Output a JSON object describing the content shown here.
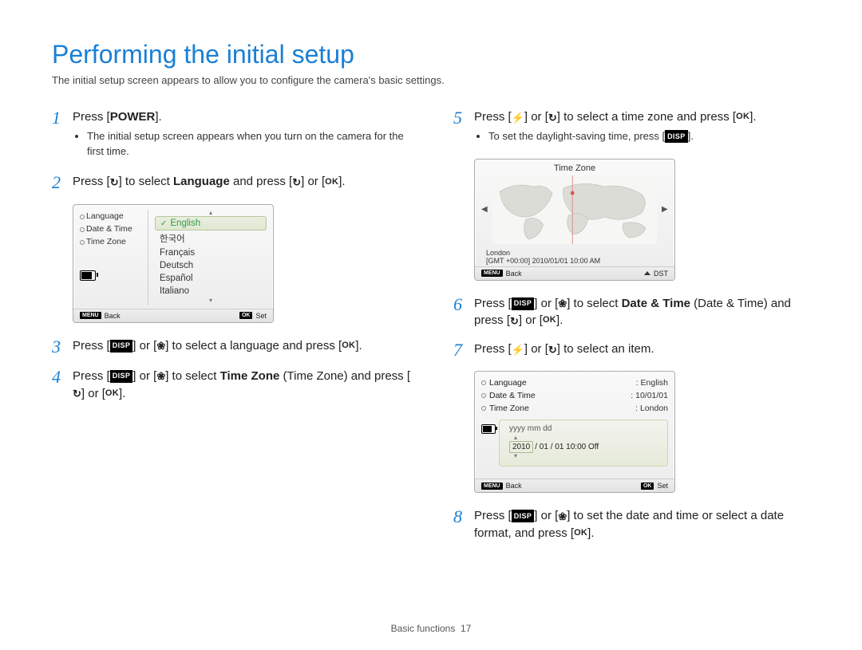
{
  "title": "Performing the initial setup",
  "subtitle": "The initial setup screen appears to allow you to configure the camera's basic settings.",
  "icons": {
    "disp_label": "DISP",
    "ok_label": "OK"
  },
  "steps": {
    "s1": {
      "num": "1",
      "pre": "Press [",
      "power": "POWER",
      "post": "].",
      "bullet": "The initial setup screen appears when you turn on the camera for the first time."
    },
    "s2": {
      "num": "2",
      "t1": "Press [",
      "t2": "] to select ",
      "lang_bold": "Language",
      "t3": " and press [",
      "t4": "] or [",
      "t5": "]."
    },
    "s3": {
      "num": "3",
      "t1": "Press [",
      "t2": "] or [",
      "t3": "] to select a language and press [",
      "t4": "]."
    },
    "s4": {
      "num": "4",
      "t1": "Press [",
      "t2": "] or [",
      "t3": "] to select ",
      "tz_bold": "Time Zone",
      "paren": " (Time Zone) and press [",
      "t4": "] or [",
      "t5": "]."
    },
    "s5": {
      "num": "5",
      "t1": "Press [",
      "t2": "] or [",
      "t3": "] to select a time zone and press [",
      "t4": "].",
      "bullet_pre": "To set the daylight-saving time, press [",
      "bullet_post": "]."
    },
    "s6": {
      "num": "6",
      "t1": "Press [",
      "t2": "] or [",
      "t3": "] to select ",
      "dt_bold": "Date & Time",
      "paren": " (Date & Time) and press [",
      "t4": "] or [",
      "t5": "]."
    },
    "s7": {
      "num": "7",
      "t1": "Press [",
      "t2": "] or [",
      "t3": "] to select an item."
    },
    "s8": {
      "num": "8",
      "t1": "Press [",
      "t2": "] or [",
      "t3": "] to set the date and time or select a date format, and press [",
      "t4": "]."
    }
  },
  "screen1": {
    "menu": [
      "Language",
      "Date & Time",
      "Time Zone"
    ],
    "langs": [
      "English",
      "한국어",
      "Français",
      "Deutsch",
      "Español",
      "Italiano"
    ],
    "foot_back": "Back",
    "foot_set": "Set",
    "menu_tag": "MENU",
    "ok_tag": "OK"
  },
  "screen2": {
    "title": "Time Zone",
    "city": "London",
    "gmt_line": "[GMT +00:00] 2010/01/01 10:00 AM",
    "foot_back": "Back",
    "foot_dst": "DST",
    "menu_tag": "MENU"
  },
  "screen3": {
    "rows": [
      {
        "k": "Language",
        "v": ": English"
      },
      {
        "k": "Date & Time",
        "v": ": 10/01/01"
      },
      {
        "k": "Time Zone",
        "v": ": London"
      }
    ],
    "format_line": "yyyy  mm  dd",
    "year": "2010",
    "rest": " / 01 / 01  10:00   Off",
    "foot_back": "Back",
    "foot_set": "Set",
    "menu_tag": "MENU",
    "ok_tag": "OK"
  },
  "footer": {
    "section": "Basic functions",
    "page": "17"
  }
}
